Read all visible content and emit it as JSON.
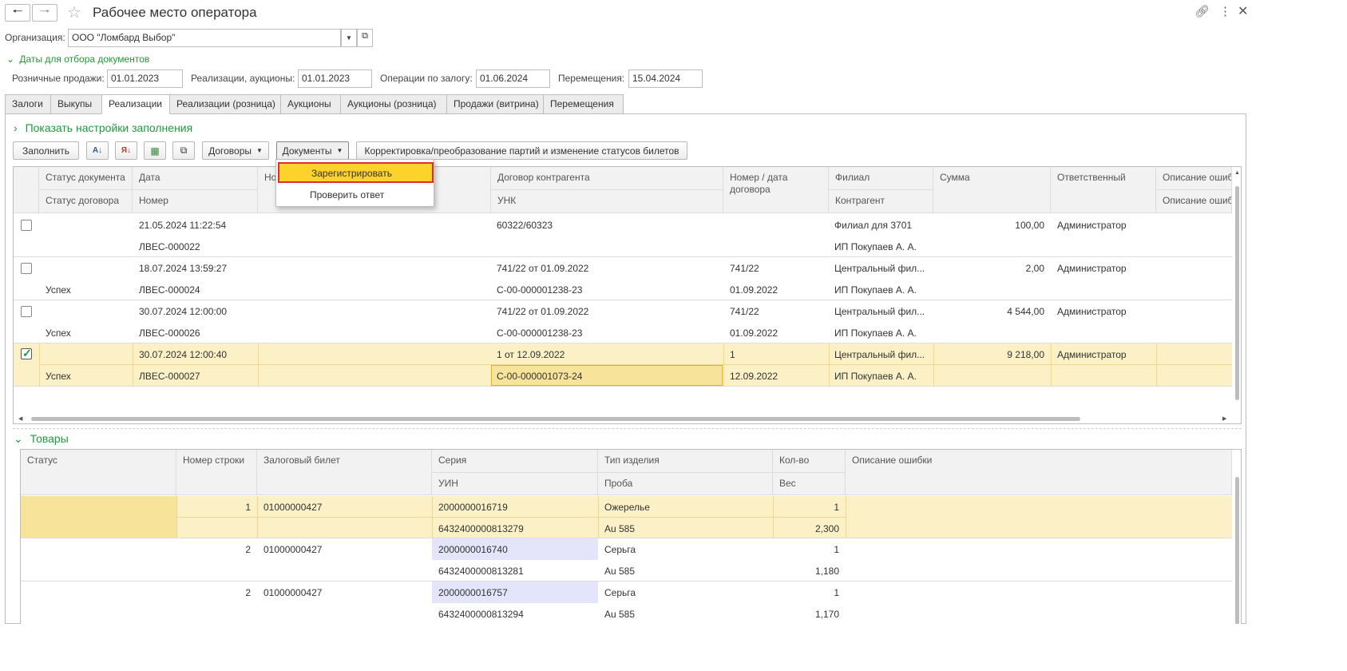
{
  "window": {
    "title": "Рабочее место оператора"
  },
  "org": {
    "label": "Организация:",
    "value": "ООО \"Ломбард Выбор\""
  },
  "dates": {
    "section_label": "Даты для отбора документов",
    "retail_label": "Розничные продажи:",
    "retail_value": "01.01.2023",
    "sales_label": "Реализации, аукционы:",
    "sales_value": "01.01.2023",
    "pledge_label": "Операции по залогу:",
    "pledge_value": "01.06.2024",
    "move_label": "Перемещения:",
    "move_value": "15.04.2024"
  },
  "tabs": [
    "Залоги",
    "Выкупы",
    "Реализации",
    "Реализации (розница)",
    "Аукционы",
    "Аукционы (розница)",
    "Продажи (витрина)",
    "Перемещения"
  ],
  "settings_link": "Показать настройки заполнения",
  "toolbar": {
    "fill": "Заполнить",
    "contracts": "Договоры",
    "documents": "Документы",
    "correction": "Корректировка/преобразование партий и изменение статусов билетов"
  },
  "menu": {
    "register": "Зарегистрировать",
    "check": "Проверить ответ"
  },
  "docs_table": {
    "headers": {
      "status": "Статус документа",
      "contract_status": "Статус договора",
      "date": "Дата",
      "number": "Номер",
      "num_partial": "Ном",
      "counterparty_contract": "Договор контрагента",
      "unk": "УНК",
      "contract_num_date": "Номер / дата договора",
      "branch": "Филиал",
      "counterparty": "Контрагент",
      "sum": "Сумма",
      "responsible": "Ответственный",
      "error1": "Описание ошиб",
      "error2": "Описание ошиб"
    },
    "rows": [
      {
        "checked": false,
        "status": "",
        "contract_status": "",
        "date": "21.05.2024 11:22:54",
        "number": "ЛВЕС-000022",
        "contract": "60322/60323",
        "unk": "",
        "cnum": "",
        "cdate": "",
        "branch": "Филиал  для 3701",
        "counterparty": "ИП Покупаев А. А.",
        "sum": "100,00",
        "responsible": "Администратор"
      },
      {
        "checked": false,
        "status": "",
        "contract_status": "Успех",
        "date": "18.07.2024 13:59:27",
        "number": "ЛВЕС-000024",
        "contract": "741/22 от 01.09.2022",
        "unk": "С-00-000001238-23",
        "cnum": "741/22",
        "cdate": "01.09.2022",
        "branch": "Центральный фил...",
        "counterparty": "ИП Покупаев А. А.",
        "sum": "2,00",
        "responsible": "Администратор"
      },
      {
        "checked": false,
        "status": "",
        "contract_status": "Успех",
        "date": "30.07.2024 12:00:00",
        "number": "ЛВЕС-000026",
        "contract": "741/22 от 01.09.2022",
        "unk": "С-00-000001238-23",
        "cnum": "741/22",
        "cdate": "01.09.2022",
        "branch": "Центральный фил...",
        "counterparty": "ИП Покупаев А. А.",
        "sum": "4 544,00",
        "responsible": "Администратор"
      },
      {
        "checked": true,
        "status": "",
        "contract_status": "Успех",
        "date": "30.07.2024 12:00:40",
        "number": "ЛВЕС-000027",
        "contract": "1 от 12.09.2022",
        "unk": "С-00-000001073-24",
        "cnum": "1",
        "cdate": "12.09.2022",
        "branch": "Центральный фил...",
        "counterparty": "ИП Покупаев А. А.",
        "sum": "9 218,00",
        "responsible": "Администратор"
      }
    ]
  },
  "goods": {
    "section_label": "Товары",
    "headers": {
      "status": "Статус",
      "line": "Номер строки",
      "ticket": "Залоговый билет",
      "series": "Серия",
      "uin": "УИН",
      "type": "Тип изделия",
      "assay": "Проба",
      "qty": "Кол-во",
      "weight": "Вес",
      "error": "Описание ошибки"
    },
    "rows": [
      {
        "line": "1",
        "ticket": "01000000427",
        "series": "2000000016719",
        "uin": "6432400000813279",
        "type": "Ожерелье",
        "assay": "Au 585",
        "qty": "1",
        "weight": "2,300"
      },
      {
        "line": "2",
        "ticket": "01000000427",
        "series": "2000000016740",
        "uin": "6432400000813281",
        "type": "Серьга",
        "assay": "Au 585",
        "qty": "1",
        "weight": "1,180"
      },
      {
        "line": "2",
        "ticket": "01000000427",
        "series": "2000000016757",
        "uin": "6432400000813294",
        "type": "Серьга",
        "assay": "Au 585",
        "qty": "1",
        "weight": "1,170"
      }
    ]
  }
}
